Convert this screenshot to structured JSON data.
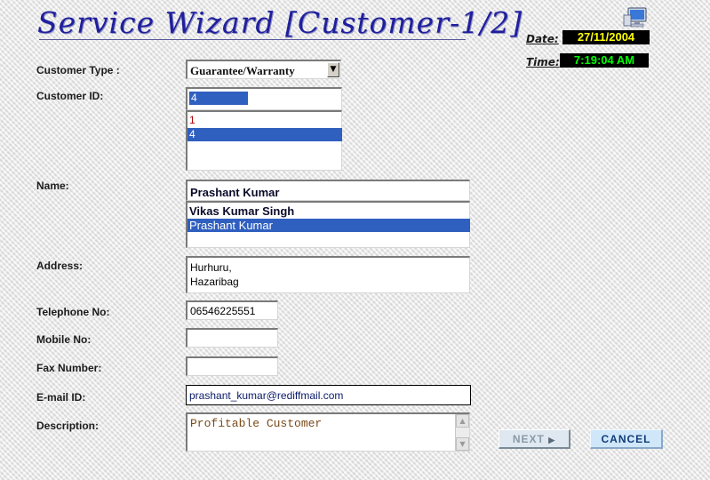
{
  "header": {
    "title": "Service Wizard [Customer-1/2]",
    "date_label": "Date:",
    "date_value": "27/11/2004",
    "time_label": "Time:",
    "time_value": "7:19:04 AM",
    "icons": {
      "computer": "computer-monitor-icon"
    }
  },
  "colors": {
    "title": "#1f1f9e",
    "date_bg": "#000000",
    "date_fg": "#ffff00",
    "time_bg": "#000000",
    "time_fg": "#00ff00",
    "selection": "#2f5fbf"
  },
  "form": {
    "customer_type": {
      "label": "Customer Type :",
      "value": "Guarantee/Warranty"
    },
    "customer_id": {
      "label": "Customer ID:",
      "value": "4",
      "list": [
        "1",
        "4"
      ],
      "selected": "4"
    },
    "name": {
      "label": "Name:",
      "value": "Prashant Kumar",
      "list": [
        "Vikas Kumar Singh",
        "Prashant Kumar"
      ],
      "selected": "Prashant Kumar"
    },
    "address": {
      "label": "Address:",
      "line1": "Hurhuru,",
      "line2": "Hazaribag"
    },
    "telephone": {
      "label": "Telephone No:",
      "value": "06546225551"
    },
    "mobile": {
      "label": "Mobile No:",
      "value": ""
    },
    "fax": {
      "label": "Fax Number:",
      "value": ""
    },
    "email": {
      "label": "E-mail ID:",
      "value": "prashant_kumar@rediffmail.com"
    },
    "description": {
      "label": "Description:",
      "value": "Profitable Customer"
    }
  },
  "buttons": {
    "next": "NEXT",
    "cancel": "CANCEL"
  }
}
